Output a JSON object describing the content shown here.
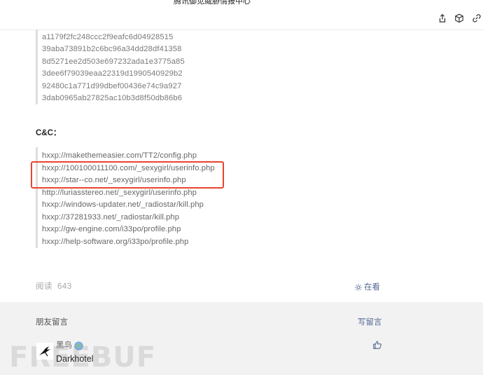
{
  "header": {
    "title": "腾讯御见威胁情报中心",
    "actions": [
      {
        "name": "share-icon"
      },
      {
        "name": "cube-icon"
      },
      {
        "name": "link-icon"
      }
    ]
  },
  "hashes": [
    "a1179f2fc248ccc2f9eafc6d04928515",
    "39aba73891b2c6bc96a34dd28df41358",
    "8d5271ee2d503e697232ada1e3775a85",
    "3dee6f79039eaa22319d1990540929b2",
    "92480c1a771d99dbef00436e74c9a927",
    "3dab0965ab27825ac10b3d8f50db86b6"
  ],
  "cc": {
    "heading": "C&C：",
    "urls": [
      "hxxp://makethemeasier.com/TT2/config.php",
      "hxxp://100100011100.com/_sexygirl/userinfo.php",
      "hxxp://star--co.net/_sexygirl/userinfo.php",
      "http://luriasstereo.net/_sexygirl/userinfo.php",
      "hxxp://windows-updater.net/_radiostar/kill.php",
      "hxxp://37281933.net/_radiostar/kill.php",
      "hxxp://gw-engine.com/i33po/profile.php",
      "hxxp://help-software.org/i33po/profile.php"
    ]
  },
  "footer": {
    "read_label": "阅读",
    "read_count": "643",
    "looking_label": "在看"
  },
  "comments": {
    "section_label": "朋友留言",
    "write_label": "写留言",
    "items": [
      {
        "name": "黑鸟",
        "text": "Darkhotel"
      }
    ]
  },
  "watermark": "FREEBUF",
  "colors": {
    "link": "#576b95",
    "highlight": "#e8452c",
    "quote_bar": "#dedede"
  }
}
